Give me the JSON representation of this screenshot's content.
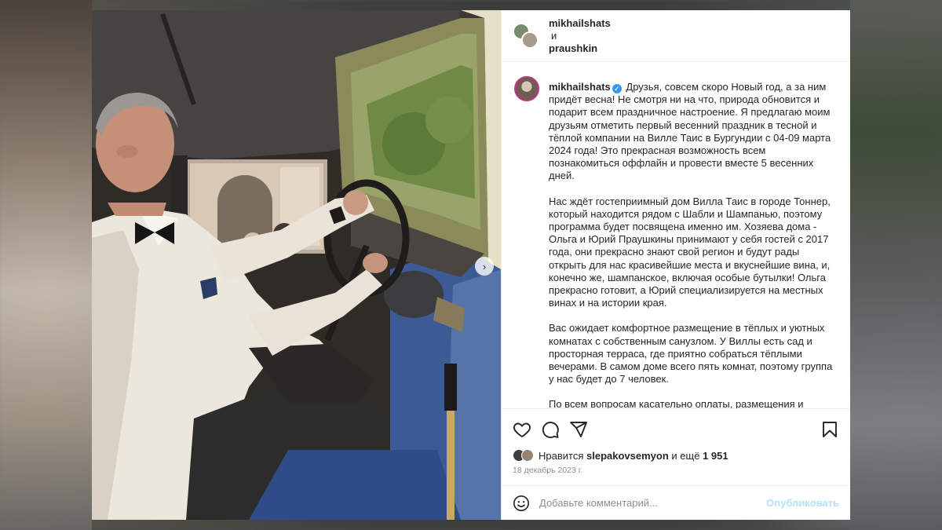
{
  "header": {
    "user1": "mikhailshats",
    "conjunction": "и",
    "user2": "praushkin"
  },
  "caption": {
    "username": "mikhailshats",
    "paragraphs": [
      "Друзья, совсем скоро Новый год, а за ним придёт весна! Не смотря ни на что, природа обновится и подарит всем праздничное настроение. Я предлагаю моим друзьям отметить первый весенний праздник в тесной и тёплой компании на Вилле Таис в Бургундии с 04-09 марта 2024 года! Это прекрасная возможность всем познакомиться оффлайн и провести вместе 5 весенних дней.",
      "Нас ждёт гостеприимный дом Вилла Таис в городе Тоннер, который находится рядом с Шабли и Шампанью, поэтому программа будет посвящена именно им. Хозяева дома - Ольга и Юрий Праушкины принимают у себя гостей с 2017 года, они прекрасно знают свой регион и будут рады открыть для нас красивейшие места и вкуснейшие вина, и, конечно же, шампанское, включая особые бутылки! Ольга прекрасно готовит, а Юрий специализируется на местных винах и на истории края.",
      "Вас ожидает комфортное размещение в тёплых и уютных комнатах с собственным санузлом. У Виллы есть сад и просторная терраса, где приятно собраться тёплыми вечерами. В самом доме всего пять комнат, поэтому группа у нас будет до 7 человек.",
      "По всем вопросам касательно оплаты, размещения и"
    ]
  },
  "likes": {
    "prefix": "Нравится",
    "user": "slepakovsemyon",
    "middle": "и ещё",
    "count": "1 951"
  },
  "date": "18 декабрь 2023 г.",
  "comment": {
    "placeholder": "Добавьте комментарий...",
    "publish": "Опубликовать"
  },
  "icons": {
    "like": "heart-icon",
    "comment": "comment-icon",
    "share": "share-icon",
    "save": "bookmark-icon",
    "emoji": "emoji-icon",
    "next": "chevron-right-icon"
  },
  "colors": {
    "accent": "#0095f6",
    "publish_disabled": "#b2dffc",
    "verified": "#3897f0"
  }
}
